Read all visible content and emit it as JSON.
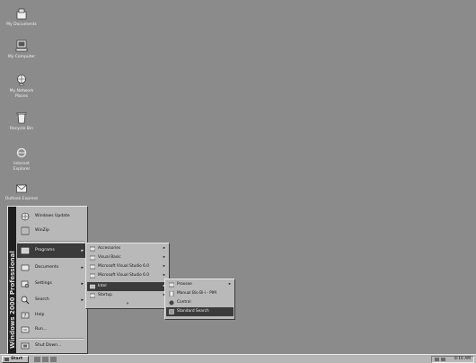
{
  "desktop": {
    "icons": [
      {
        "name": "my-documents-icon",
        "label": "My Documents"
      },
      {
        "name": "my-computer-icon",
        "label": "My Computer"
      },
      {
        "name": "my-network-places-icon",
        "label": "My Network Places"
      },
      {
        "name": "recycle-bin-icon",
        "label": "Recycle Bin"
      },
      {
        "name": "internet-explorer-icon",
        "label": "Internet Explorer"
      },
      {
        "name": "outlook-express-icon",
        "label": "Outlook Express"
      }
    ]
  },
  "start_menu": {
    "banner": "Windows 2000 Professional",
    "items": [
      {
        "name": "windows-update",
        "label": "Windows Update",
        "icon": "globe-icon"
      },
      {
        "name": "winzip",
        "label": "WinZip",
        "icon": "archive-icon"
      },
      {
        "name": "programs",
        "label": "Programs",
        "icon": "programs-icon",
        "submenu": true,
        "selected": true
      },
      {
        "name": "documents",
        "label": "Documents",
        "icon": "documents-icon",
        "submenu": true
      },
      {
        "name": "settings",
        "label": "Settings",
        "icon": "settings-icon",
        "submenu": true
      },
      {
        "name": "search",
        "label": "Search",
        "icon": "search-icon",
        "submenu": true
      },
      {
        "name": "help",
        "label": "Help",
        "icon": "help-icon"
      },
      {
        "name": "run",
        "label": "Run...",
        "icon": "run-icon"
      },
      {
        "name": "shut-down",
        "label": "Shut Down...",
        "icon": "shutdown-icon"
      }
    ]
  },
  "programs_menu": {
    "items": [
      {
        "label": "Accessories",
        "submenu": true
      },
      {
        "label": "Visual Basic",
        "submenu": true
      },
      {
        "label": "Microsoft Visual Studio 6.0",
        "submenu": true
      },
      {
        "label": "Microsoft Visual Studio 6.0",
        "submenu": true
      },
      {
        "label": "Intel",
        "submenu": true,
        "selected": true
      },
      {
        "label": "Startup",
        "submenu": true
      }
    ],
    "more_indicator": "»"
  },
  "intel_menu": {
    "items": [
      {
        "label": "Proxsee",
        "submenu": true
      },
      {
        "label": "Manual Bio Bi-i - PIM"
      },
      {
        "label": "Control"
      },
      {
        "label": "Standard Search",
        "selected": true
      }
    ]
  },
  "taskbar": {
    "start_label": "Start",
    "clock": "8:16 AM"
  }
}
